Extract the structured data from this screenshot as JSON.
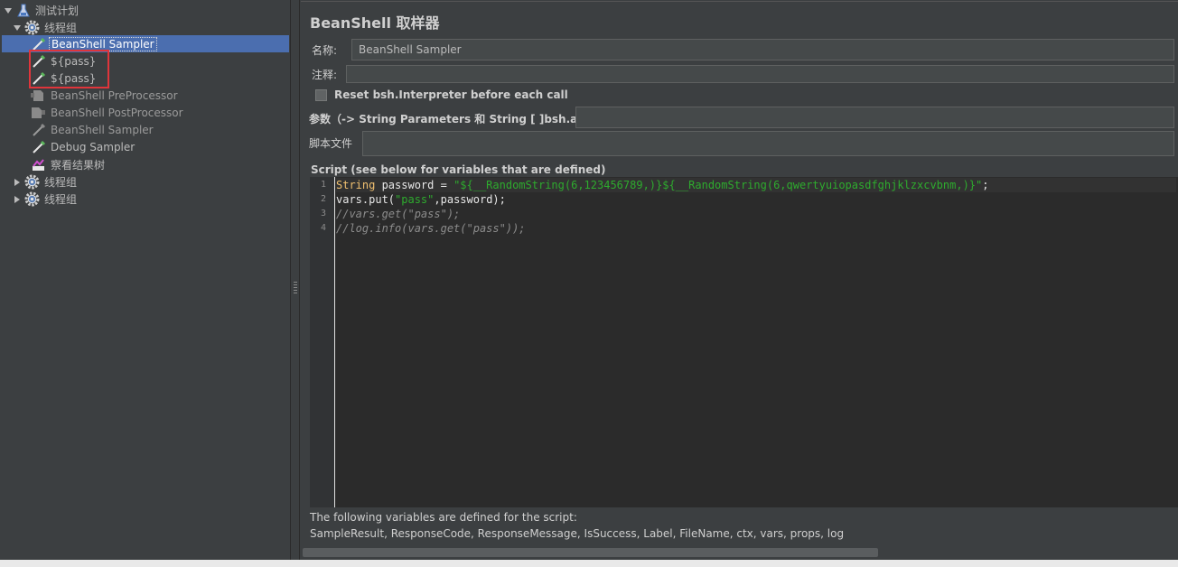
{
  "tree": {
    "items": [
      {
        "label": "测试计划",
        "icon": "test-plan-icon",
        "expanded": true
      },
      {
        "label": "线程组",
        "icon": "gear-icon",
        "expanded": true
      },
      {
        "label": "BeanShell Sampler",
        "icon": "pipette-sampler-icon",
        "selected": true
      },
      {
        "label": "${pass}",
        "icon": "pipette-sampler-icon"
      },
      {
        "label": "${pass}",
        "icon": "pipette-sampler-icon"
      },
      {
        "label": "BeanShell PreProcessor",
        "icon": "preprocessor-icon",
        "disabled": true
      },
      {
        "label": "BeanShell PostProcessor",
        "icon": "postprocessor-icon",
        "disabled": true
      },
      {
        "label": "BeanShell Sampler",
        "icon": "pipette-sampler-icon",
        "disabled": true
      },
      {
        "label": "Debug Sampler",
        "icon": "pipette-sampler-icon"
      },
      {
        "label": "察看结果树",
        "icon": "results-tree-icon"
      },
      {
        "label": "线程组",
        "icon": "gear-icon",
        "expanded": false
      },
      {
        "label": "线程组",
        "icon": "gear-icon",
        "expanded": false
      }
    ],
    "highlight_color": "#e0353b"
  },
  "panel": {
    "title": "BeanShell 取样器",
    "name_label": "名称:",
    "name_value": "BeanShell Sampler",
    "comment_label": "注释:",
    "comment_value": "",
    "reset_label": "Reset bsh.Interpreter before each call",
    "reset_checked": false,
    "params_label": "参数（-> String Parameters 和 String [ ]bsh.args）",
    "params_value": "",
    "script_file_label": "脚本文件",
    "script_file_value": "",
    "script_title": "Script (see below for variables that are defined)",
    "script": {
      "line_numbers": [
        "1",
        "2",
        "3",
        "4"
      ],
      "lines": [
        {
          "tokens": [
            {
              "t": "kw",
              "v": "String"
            },
            {
              "t": "pl",
              "v": " password = "
            },
            {
              "t": "str",
              "v": "\"${__RandomString(6,123456789,)}${__RandomString(6,qwertyuiopasdfghjklzxcvbnm,)}\""
            },
            {
              "t": "pl",
              "v": ";"
            }
          ]
        },
        {
          "tokens": [
            {
              "t": "pl",
              "v": "vars.put("
            },
            {
              "t": "str",
              "v": "\"pass\""
            },
            {
              "t": "pl",
              "v": ",password);"
            }
          ]
        },
        {
          "tokens": [
            {
              "t": "cm",
              "v": "//vars.get(\"pass\");"
            }
          ]
        },
        {
          "tokens": [
            {
              "t": "cm",
              "v": "//log.info(vars.get(\"pass\"));"
            }
          ]
        }
      ]
    },
    "vars_title": "The following variables are defined for the script:",
    "vars_list": "SampleResult, ResponseCode, ResponseMessage, IsSuccess, Label, FileName, ctx, vars, props, log"
  },
  "colors": {
    "background": "#3c3f41",
    "selection": "#4b6eaf",
    "editor_bg": "#2b2b2b",
    "keyword": "#f0c070",
    "string": "#2eab2e",
    "comment": "#8c8c8c"
  }
}
